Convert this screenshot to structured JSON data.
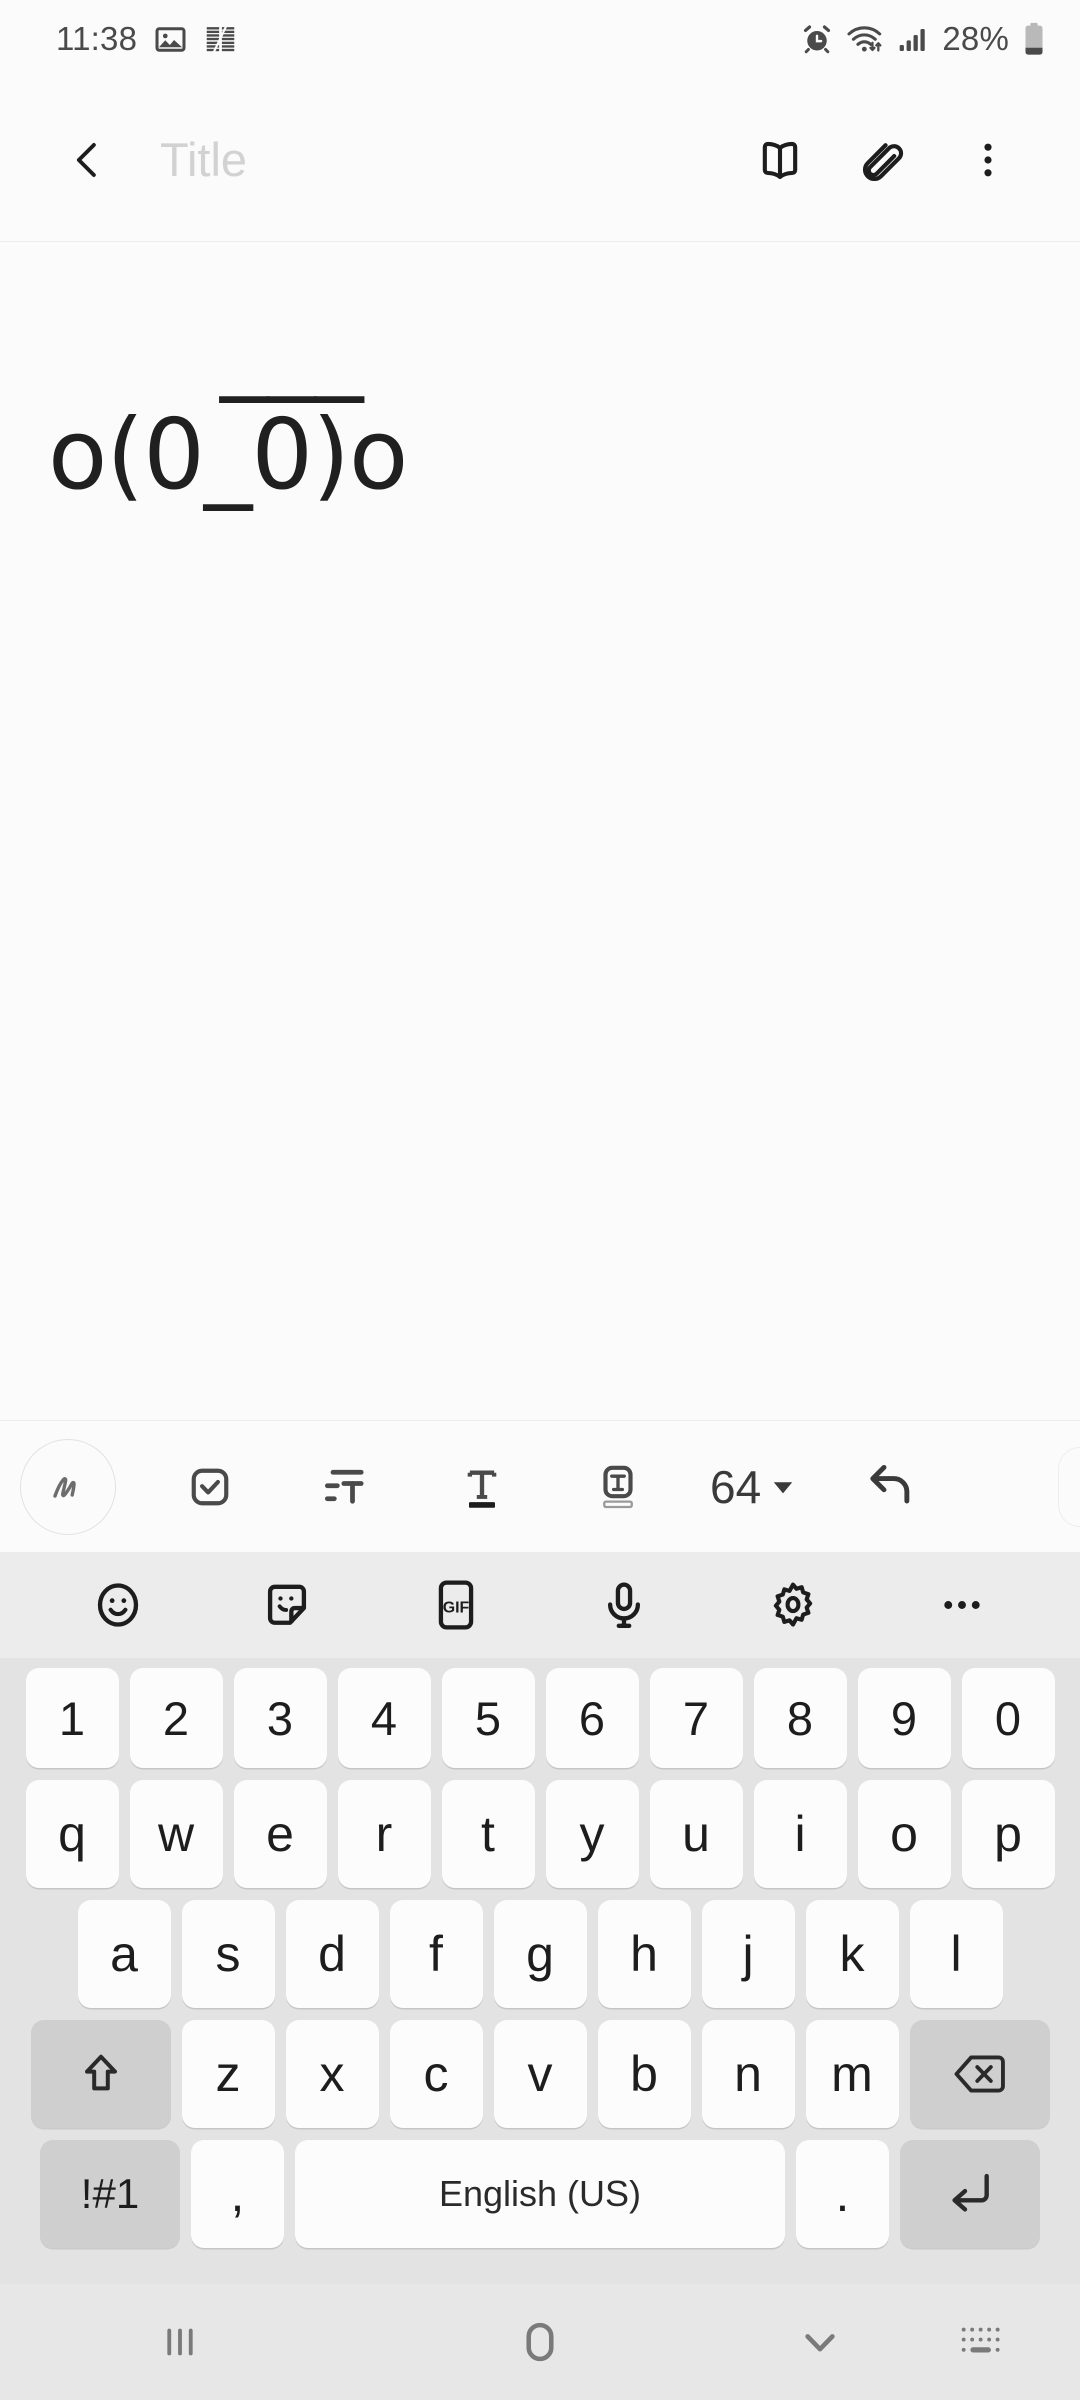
{
  "status_bar": {
    "time": "11:38",
    "battery_percent": "28%",
    "left_icons": [
      "gallery-icon",
      "archiver-icon"
    ],
    "right_icons": [
      "alarm-icon",
      "wifi-icon",
      "signal-icon",
      "battery-icon"
    ]
  },
  "app_bar": {
    "back_label": "back-icon",
    "title_placeholder": "Title",
    "actions": [
      {
        "name": "reading-mode-icon",
        "label": "Reading mode"
      },
      {
        "name": "attach-icon",
        "label": "Attach"
      },
      {
        "name": "more-options-icon",
        "label": "More options"
      }
    ]
  },
  "note": {
    "line1": "___",
    "line2": "o(0_0)o"
  },
  "format_bar": {
    "pen_label": "handwriting-mode",
    "buttons": [
      {
        "name": "checklist-icon",
        "label": "Checklist"
      },
      {
        "name": "paragraph-style-icon",
        "label": "Paragraph style"
      },
      {
        "name": "text-style-icon",
        "label": "Text style"
      },
      {
        "name": "text-box-icon",
        "label": "Text box"
      }
    ],
    "font_size": "64",
    "undo_label": "Undo"
  },
  "keyboard": {
    "toolbar": [
      {
        "name": "emoji-icon",
        "label": "Emoji"
      },
      {
        "name": "sticker-icon",
        "label": "Stickers"
      },
      {
        "name": "gif-icon",
        "label": "GIF"
      },
      {
        "name": "microphone-icon",
        "label": "Voice input"
      },
      {
        "name": "settings-gear-icon",
        "label": "Keyboard settings"
      },
      {
        "name": "more-icon",
        "label": "More"
      }
    ],
    "gif_label": "GIF",
    "rows": {
      "numbers": [
        "1",
        "2",
        "3",
        "4",
        "5",
        "6",
        "7",
        "8",
        "9",
        "0"
      ],
      "top": [
        "q",
        "w",
        "e",
        "r",
        "t",
        "y",
        "u",
        "i",
        "o",
        "p"
      ],
      "home": [
        "a",
        "s",
        "d",
        "f",
        "g",
        "h",
        "j",
        "k",
        "l"
      ],
      "bottom": [
        "z",
        "x",
        "c",
        "v",
        "b",
        "n",
        "m"
      ]
    },
    "shift_label": "shift-icon",
    "backspace_label": "backspace-icon",
    "symbols_label": "!#1",
    "comma_label": ",",
    "space_label": "English (US)",
    "period_label": ".",
    "enter_label": "enter-icon"
  },
  "nav_bar": {
    "recents_label": "recents-icon",
    "home_label": "home-icon",
    "hide_keyboard_label": "hide-keyboard-icon",
    "keyboard_switch_label": "keyboard-switch-icon"
  },
  "colors": {
    "page_bg": "#FBFBFB",
    "keyboard_bg": "#E3E3E3",
    "key_bg": "#FCFCFC",
    "key_gray": "#CFCFCF",
    "nav_bg": "#E7E7E7",
    "text": "#1D1D1D",
    "placeholder": "#D2D2D2"
  }
}
